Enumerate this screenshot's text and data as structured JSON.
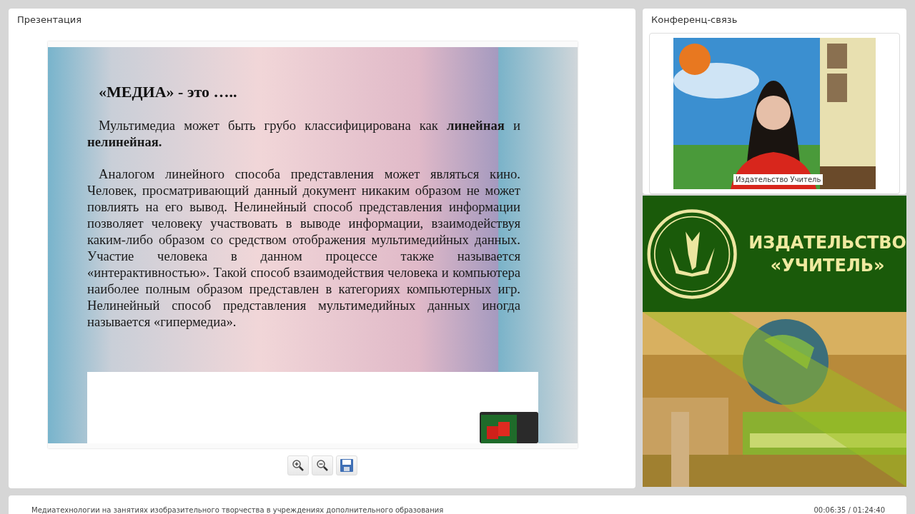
{
  "presentation": {
    "title": "Презентация",
    "slide": {
      "heading": "«МЕДИА» - это …..",
      "paragraphs": [
        "Мультимедиа может быть грубо классифицирована как **линейная** и **нелинейная.**",
        "Аналогом линейного способа представления может являться кино. Человек, просматривающий данный документ никаким образом не может повлиять на его вывод. Нелинейный способ представления информации позволяет человеку участвовать в выводе информации, взаимодействуя каким-либо образом со средством отображения мультимедийных данных. Участие человека в данном процессе также называется «интерактивностью». Такой способ взаимодействия человека и компьютера наиболее полным образом представлен в категориях компьютерных игр. Нелинейный способ представления мультимедийных данных иногда называется «гипермедиа»."
      ]
    },
    "tools": [
      {
        "kind": "zoom-in"
      },
      {
        "kind": "zoom-out"
      },
      {
        "kind": "save"
      }
    ]
  },
  "conference": {
    "title": "Конференц-связь",
    "video": {
      "caption": "Издательство Учитель"
    }
  },
  "banner": {
    "line_1": "ИЗДАТЕЛЬСТВО",
    "line_2": "«УЧИТЕЛЬ»"
  },
  "status_bar": {
    "course": "Медиатехнологии на занятиях изобразительного творчества в учреждениях дополнительного образования",
    "time": "00:06:35 / 01:24:40"
  }
}
